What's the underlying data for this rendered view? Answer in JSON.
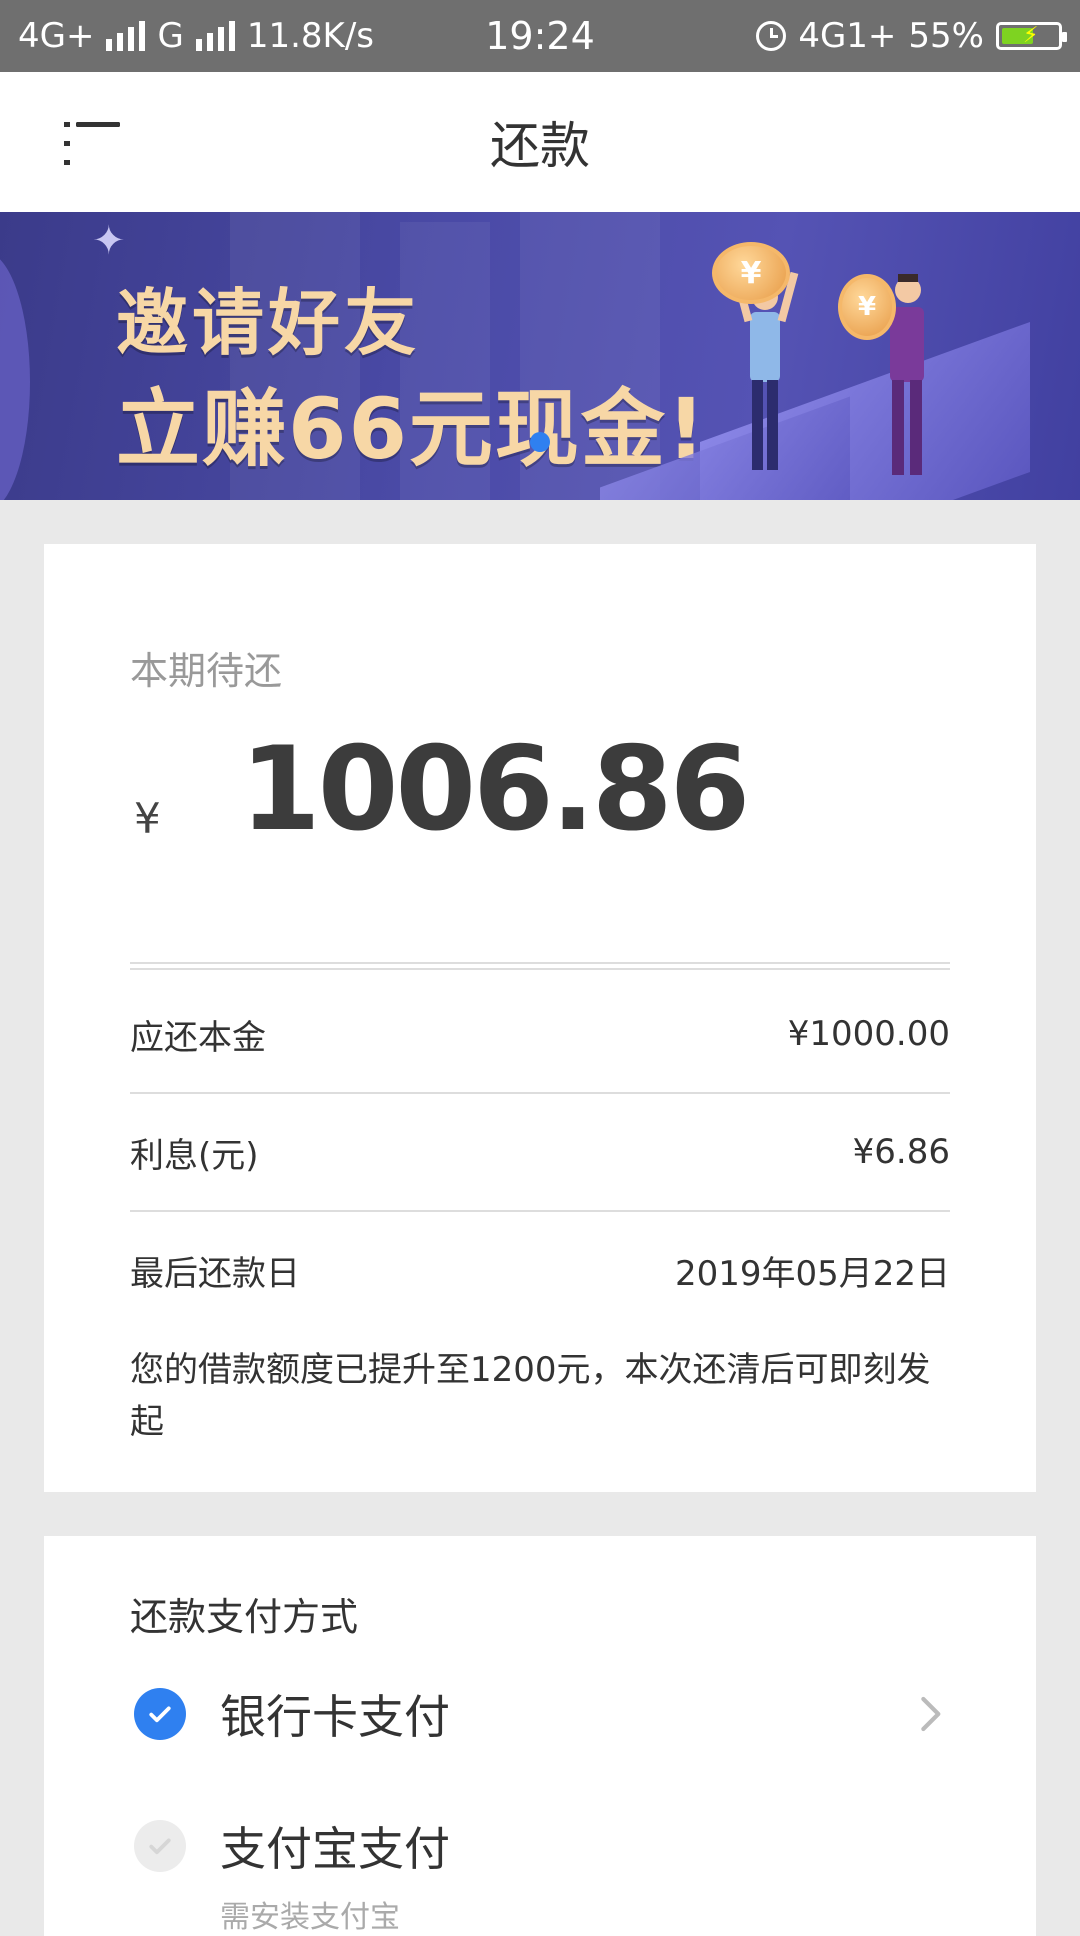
{
  "status_bar": {
    "network1": "4G+",
    "network2": "G",
    "speed": "11.8K/s",
    "time": "19:24",
    "network3": "4G1+",
    "battery": "55%"
  },
  "header": {
    "title": "还款"
  },
  "banner": {
    "line1": "邀请好友",
    "line2": "立赚66元现金!"
  },
  "repayment": {
    "label": "本期待还",
    "currency": "¥",
    "amount": "1006.86",
    "rows": [
      {
        "label": "应还本金",
        "value": "¥1000.00"
      },
      {
        "label": "利息(元)",
        "value": "¥6.86"
      },
      {
        "label": "最后还款日",
        "value": "2019年05月22日"
      }
    ],
    "notice": "您的借款额度已提升至1200元，本次还清后可即刻发起"
  },
  "payment": {
    "title": "还款支付方式",
    "options": [
      {
        "label": "银行卡支付",
        "selected": true
      },
      {
        "label": "支付宝支付",
        "selected": false,
        "note": "需安装支付宝"
      }
    ]
  },
  "colors": {
    "accent": "#2f80f0",
    "banner_text": "#f7d7a6",
    "banner_bg": "#4a4aa6"
  }
}
